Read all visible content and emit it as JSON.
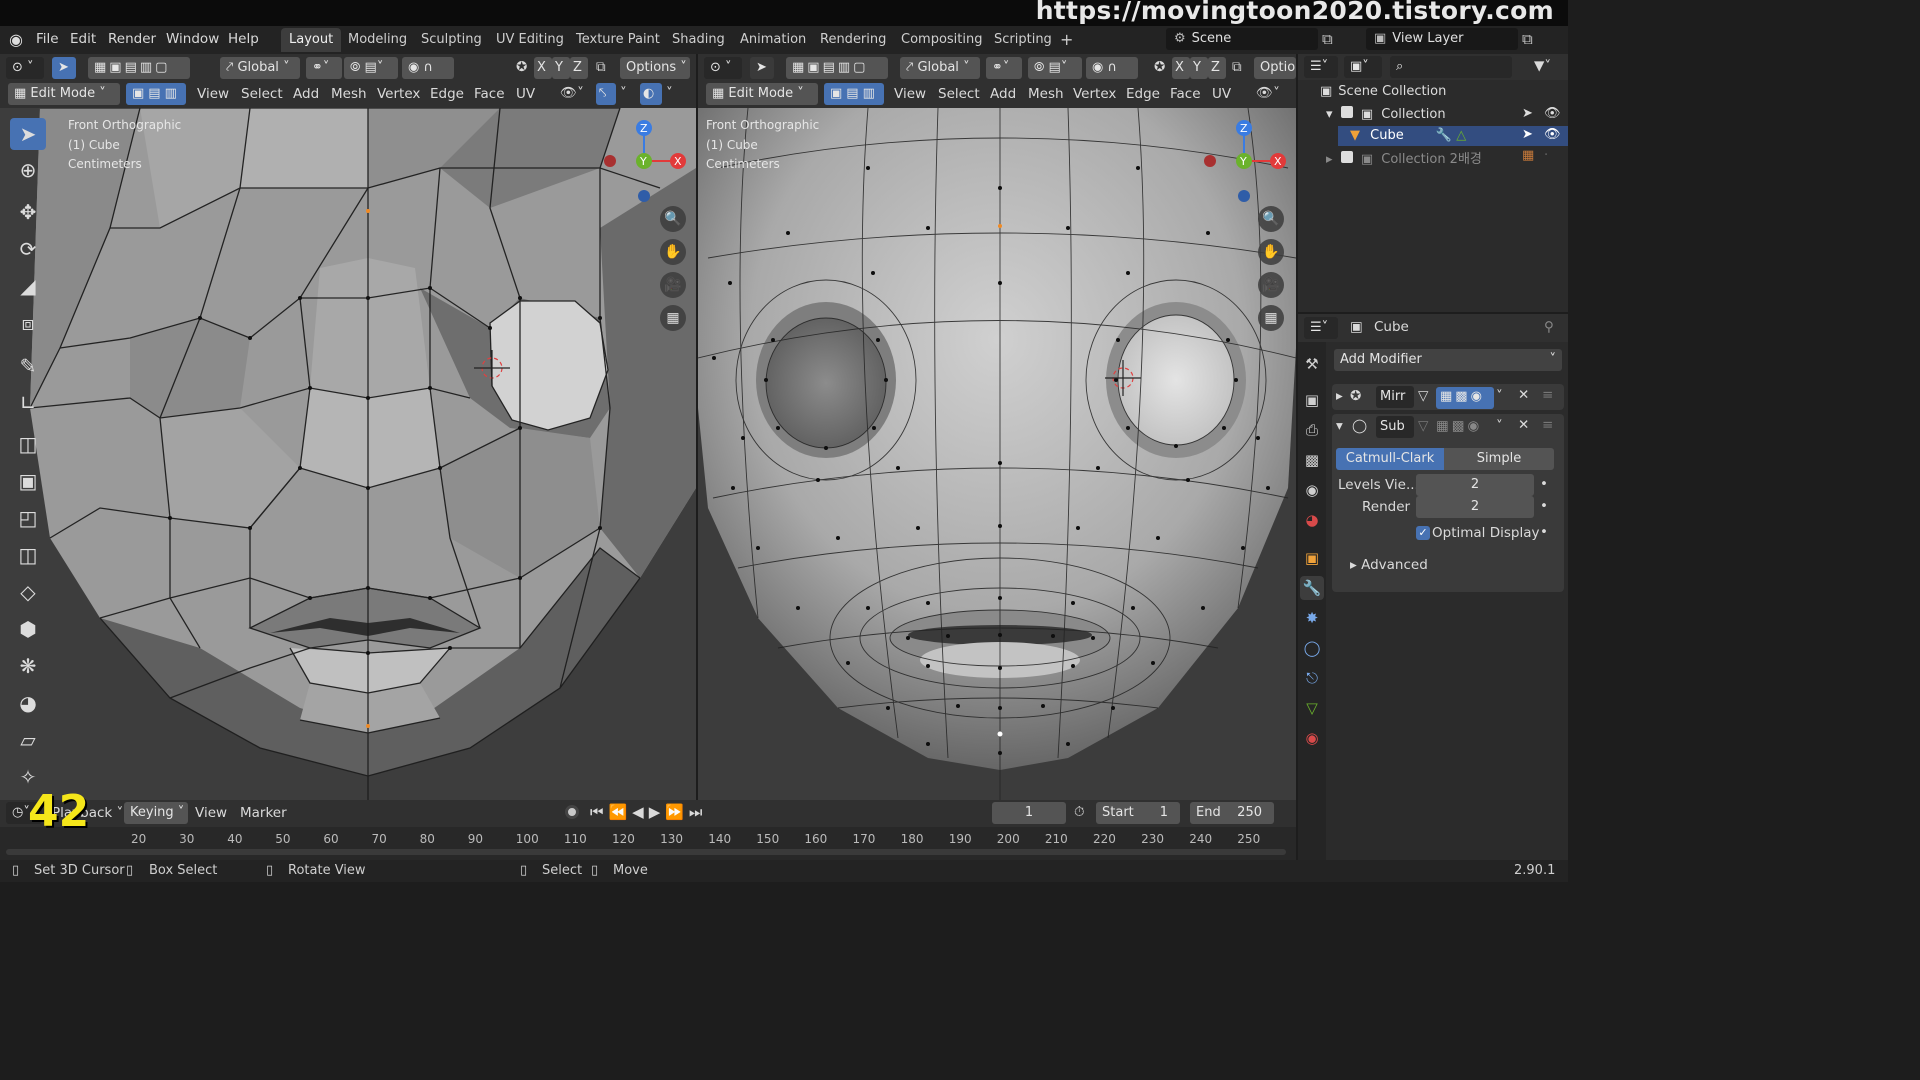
{
  "watermark": "https://movingtoon2020.tistory.com",
  "menu": [
    "File",
    "Edit",
    "Render",
    "Window",
    "Help"
  ],
  "workspaces": [
    "Layout",
    "Modeling",
    "Sculpting",
    "UV Editing",
    "Texture Paint",
    "Shading",
    "Animation",
    "Rendering",
    "Compositing",
    "Scripting"
  ],
  "active_workspace": "Layout",
  "scene": "Scene",
  "view_layer": "View Layer",
  "left_vp": {
    "transform": "Global",
    "axes": [
      "X",
      "Y",
      "Z"
    ],
    "options": "Options",
    "mode": "Edit Mode",
    "menus": [
      "View",
      "Select",
      "Add",
      "Mesh",
      "Vertex",
      "Edge",
      "Face",
      "UV"
    ],
    "info": [
      "Front Orthographic",
      "(1) Cube",
      "Centimeters"
    ]
  },
  "right_vp": {
    "transform": "Global",
    "axes": [
      "X",
      "Y",
      "Z"
    ],
    "options": "Optio",
    "mode": "Edit Mode",
    "menus": [
      "View",
      "Select",
      "Add",
      "Mesh",
      "Vertex",
      "Edge",
      "Face",
      "UV"
    ],
    "info": [
      "Front Orthographic",
      "(1) Cube",
      "Centimeters"
    ]
  },
  "gizmo_axes": {
    "z": "Z",
    "y": "Y",
    "x": "X"
  },
  "outliner": {
    "root": "Scene Collection",
    "items": [
      {
        "label": "Collection"
      },
      {
        "label": "Cube"
      },
      {
        "label": "Collection 2배경"
      }
    ]
  },
  "properties": {
    "object": "Cube",
    "add_modifier": "Add Modifier",
    "modifiers": [
      {
        "name": "Mirr"
      },
      {
        "name": "Sub"
      }
    ],
    "subdiv_types": [
      "Catmull-Clark",
      "Simple"
    ],
    "active_subdiv": "Catmull-Clark",
    "levels_label": "Levels Vie...",
    "levels_value": "2",
    "render_label": "Render",
    "render_value": "2",
    "optimal_display": "Optimal Display",
    "advanced": "Advanced"
  },
  "timeline": {
    "playback": "Playback",
    "keying": "Keying",
    "view": "View",
    "marker": "Marker",
    "current_frame": "1",
    "start_label": "Start",
    "start": "1",
    "end_label": "End",
    "end": "250",
    "ticks": [
      "20",
      "30",
      "40",
      "50",
      "60",
      "70",
      "80",
      "90",
      "100",
      "110",
      "120",
      "130",
      "140",
      "150",
      "160",
      "170",
      "180",
      "190",
      "200",
      "210",
      "220",
      "230",
      "240",
      "250"
    ],
    "overlay_number": "42"
  },
  "status": {
    "set_cursor": "Set 3D Cursor",
    "box_select": "Box Select",
    "rotate_view": "Rotate View",
    "select": "Select",
    "move": "Move",
    "version": "2.90.1"
  },
  "colors": {
    "accent": "#4772b3",
    "x_axis": "#e23a3a",
    "y_axis": "#6bb22c",
    "z_axis": "#3a7ce2"
  }
}
